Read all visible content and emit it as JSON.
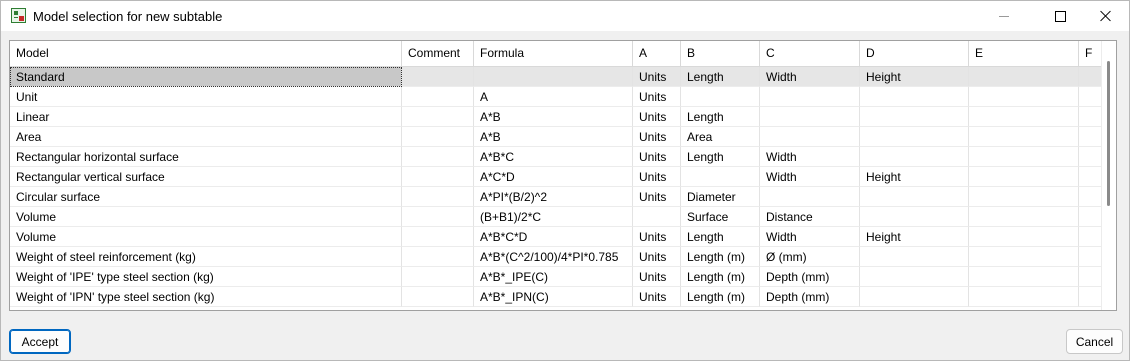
{
  "window": {
    "title": "Model selection for new subtable",
    "icon": "spreadsheet-icon"
  },
  "table": {
    "columns": [
      "Model",
      "Comment",
      "Formula",
      "A",
      "B",
      "C",
      "D",
      "E",
      "F"
    ],
    "rows": [
      [
        "Standard",
        "",
        "",
        "Units",
        "Length",
        "Width",
        "Height",
        "",
        ""
      ],
      [
        "Unit",
        "",
        "A",
        "Units",
        "",
        "",
        "",
        "",
        ""
      ],
      [
        "Linear",
        "",
        "A*B",
        "Units",
        "Length",
        "",
        "",
        "",
        ""
      ],
      [
        "Area",
        "",
        "A*B",
        "Units",
        "Area",
        "",
        "",
        "",
        ""
      ],
      [
        "Rectangular horizontal surface",
        "",
        "A*B*C",
        "Units",
        "Length",
        "Width",
        "",
        "",
        ""
      ],
      [
        "Rectangular vertical surface",
        "",
        "A*C*D",
        "Units",
        "",
        "Width",
        "Height",
        "",
        ""
      ],
      [
        "Circular surface",
        "",
        "A*PI*(B/2)^2",
        "Units",
        "Diameter",
        "",
        "",
        "",
        ""
      ],
      [
        "Volume",
        "",
        "(B+B1)/2*C",
        "",
        "Surface",
        "Distance",
        "",
        "",
        ""
      ],
      [
        "Volume",
        "",
        "A*B*C*D",
        "Units",
        "Length",
        "Width",
        "Height",
        "",
        ""
      ],
      [
        "Weight of steel reinforcement (kg)",
        "",
        "A*B*(C^2/100)/4*PI*0.785",
        "Units",
        "Length (m)",
        "Ø (mm)",
        "",
        "",
        ""
      ],
      [
        "Weight of 'IPE' type steel section (kg)",
        "",
        "A*B*_IPE(C)",
        "Units",
        "Length (m)",
        "Depth (mm)",
        "",
        "",
        ""
      ],
      [
        "Weight of 'IPN' type steel section (kg)",
        "",
        "A*B*_IPN(C)",
        "Units",
        "Length (m)",
        "Depth (mm)",
        "",
        "",
        ""
      ]
    ],
    "selected_row": 0
  },
  "buttons": {
    "accept": "Accept",
    "cancel": "Cancel"
  }
}
